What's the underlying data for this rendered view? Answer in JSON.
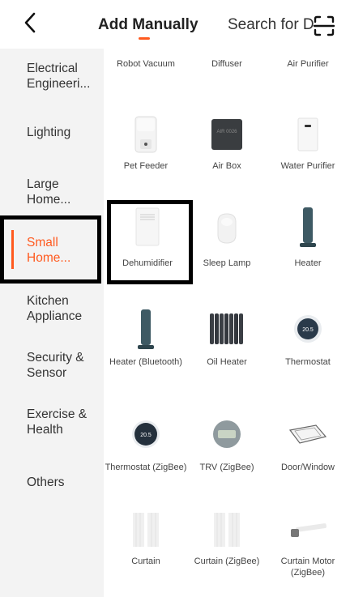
{
  "header": {
    "tab_add": "Add Manually",
    "tab_search": "Search for D"
  },
  "sidebar": {
    "items": [
      {
        "label": "Electrical Engineeri..."
      },
      {
        "label": "Lighting"
      },
      {
        "label": "Large Home..."
      },
      {
        "label": "Small Home..."
      },
      {
        "label": "Kitchen Appliance"
      },
      {
        "label": "Security & Sensor"
      },
      {
        "label": "Exercise & Health"
      },
      {
        "label": "Others"
      }
    ],
    "active_index": 3
  },
  "devices": [
    {
      "label": "Robot Vacuum"
    },
    {
      "label": "Diffuser"
    },
    {
      "label": "Air Purifier"
    },
    {
      "label": "Pet Feeder"
    },
    {
      "label": "Air Box",
      "icon_text": "AIR 0026"
    },
    {
      "label": "Water Purifier"
    },
    {
      "label": "Dehumidifier"
    },
    {
      "label": "Sleep Lamp"
    },
    {
      "label": "Heater"
    },
    {
      "label": "Heater (Bluetooth)"
    },
    {
      "label": "Oil Heater"
    },
    {
      "label": "Thermostat",
      "icon_text": "20.5"
    },
    {
      "label": "Thermostat (ZigBee)",
      "icon_text": "20.5"
    },
    {
      "label": "TRV (ZigBee)"
    },
    {
      "label": "Door/Window"
    },
    {
      "label": "Curtain"
    },
    {
      "label": "Curtain (ZigBee)"
    },
    {
      "label": "Curtain Motor (ZigBee)"
    }
  ],
  "colors": {
    "accent": "#ff5a1f",
    "sidebar_bg": "#f3f3f3"
  }
}
